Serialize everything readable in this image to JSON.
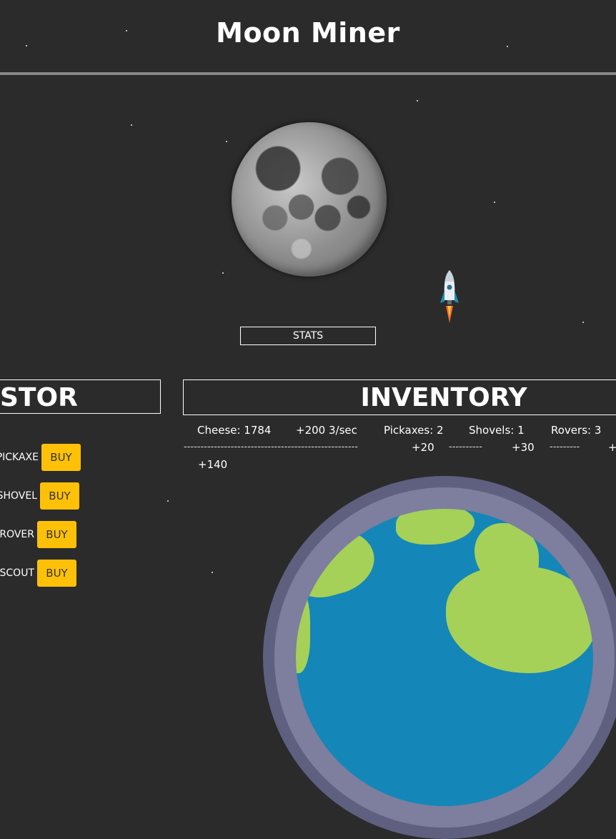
{
  "app": {
    "title": "Moon Miner"
  },
  "stats_button": {
    "label": "STATS"
  },
  "store": {
    "title": "STORE",
    "items": [
      {
        "label": "PICKAXE:",
        "buy": "BUY"
      },
      {
        "label": "SHOVEL:",
        "buy": "BUY"
      },
      {
        "label": "ROVER:",
        "buy": "BUY"
      },
      {
        "label": "SCOUT:",
        "buy": "BUY"
      }
    ]
  },
  "inventory": {
    "title": "INVENTORY",
    "cheese": "Cheese: 1784",
    "rate": "+200 3/sec",
    "pickaxes": "Pickaxes: 2",
    "shovels": "Shovels: 1",
    "rovers": "Rovers: 3",
    "pickaxe_bonus": "+20",
    "shovel_bonus": "+30",
    "rover_bonus": "+140",
    "dashes_long": "----------------------------------------------------",
    "dashes_short": "----------",
    "dashes_short2": "---------",
    "overflow_plus": "+"
  },
  "colors": {
    "background": "#2b2b2b",
    "buy_button": "#ffc107",
    "divider": "#888888"
  },
  "icons": [
    "moon-image",
    "rocket-icon",
    "earth-image"
  ]
}
